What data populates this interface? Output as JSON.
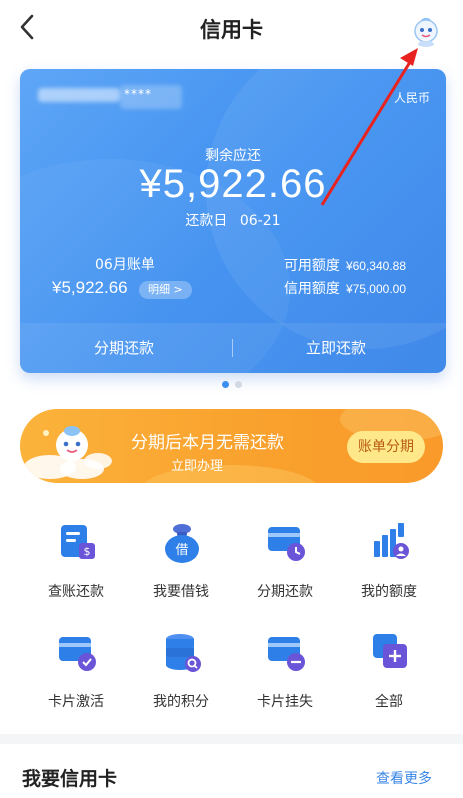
{
  "header": {
    "title": "信用卡"
  },
  "card": {
    "number_mask": "****",
    "currency": "人民币",
    "due_label": "剩余应还",
    "due_amount": "¥5,922.66",
    "due_date_label": "还款日",
    "due_date": "06-21",
    "bill_label": "06月账单",
    "bill_amount": "¥5,922.66",
    "detail_label": "明细 >",
    "available_label": "可用额度",
    "available_value": "¥60,340.88",
    "credit_label": "信用额度",
    "credit_value": "¥75,000.00",
    "installment_label": "分期还款",
    "repay_label": "立即还款"
  },
  "banner": {
    "title": "分期后本月无需还款",
    "subtitle": "立即办理",
    "button": "账单分期"
  },
  "grid": [
    {
      "label": "查账还款",
      "icon": "bill-payment-icon"
    },
    {
      "label": "我要借钱",
      "icon": "loan-bag-icon"
    },
    {
      "label": "分期还款",
      "icon": "installment-card-icon"
    },
    {
      "label": "我的额度",
      "icon": "limit-chart-icon"
    },
    {
      "label": "卡片激活",
      "icon": "card-activate-icon"
    },
    {
      "label": "我的积分",
      "icon": "points-coins-icon"
    },
    {
      "label": "卡片挂失",
      "icon": "card-lost-icon"
    },
    {
      "label": "全部",
      "icon": "all-services-icon"
    }
  ],
  "section": {
    "title": "我要信用卡",
    "more": "查看更多"
  },
  "colors": {
    "card_blue": "#3c8ef0",
    "banner_orange": "#f9a02d",
    "icon_blue": "#2f7fe8",
    "icon_purple": "#6a55d8",
    "link_blue": "#3a86e8"
  }
}
